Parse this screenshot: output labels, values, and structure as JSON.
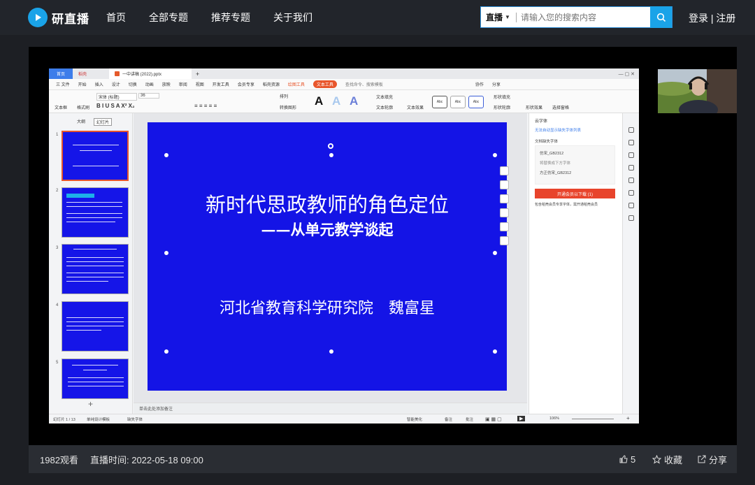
{
  "site": {
    "brand": "研直播",
    "nav": [
      "首页",
      "全部专题",
      "推荐专题",
      "关于我们"
    ],
    "search_type": "直播",
    "search_placeholder": "请输入您的搜索内容",
    "login": "登录",
    "register": "注册",
    "accent": "#1aa3e8"
  },
  "app": {
    "tabs": {
      "home": "首页",
      "docs": "稻壳",
      "file": "一中讲稿 (2022).pptx"
    },
    "menu": [
      "三 文件",
      "开始",
      "插入",
      "设计",
      "切换",
      "动画",
      "放映",
      "审阅",
      "视图",
      "开发工具",
      "会员专享",
      "稻壳资源"
    ],
    "menu_orange": "绘图工具",
    "menu_active": "文本工具",
    "search_cmd": "查找命令、搜索模板",
    "share": [
      "协作",
      "分享"
    ],
    "ribbon": {
      "font": "宋体 (标题)",
      "size": "36",
      "textbox": "文本框",
      "style": "格式刷",
      "layout": "排列",
      "convert": "转换图形",
      "fill": "文本填充",
      "outline": "文本轮廓",
      "effect": "文本效果",
      "abc": "Abc",
      "shape_fill": "形状填充",
      "shape_outline": "形状轮廓",
      "shape_effect": "形状效果",
      "arrange": "选择窗格"
    },
    "left_tabs": [
      "大纲",
      "幻灯片"
    ],
    "thumb_numbers": [
      "1",
      "2",
      "3",
      "4",
      "5"
    ],
    "slide": {
      "title": "新时代思政教师的角色定位",
      "subtitle": "——从单元教学谈起",
      "author": "河北省教育科学研究院　魏富星",
      "color": "#1414e6"
    },
    "notes": "单击此处添加备注",
    "right_pane": {
      "title": "云字体",
      "link": "无法自动显示缺失字体列表",
      "section": "文档缺失字体",
      "card": [
        "仿宋_GB2312",
        "将替换成下方字体",
        "方正仿宋_GB2312"
      ],
      "button": "开通会员以下载 (1)",
      "warn": "包含稻壳会员专享字体，需开通稻壳会员"
    },
    "status": {
      "slide_no": "幻灯片 1 / 13",
      "design": "单纯设计模板",
      "font_missing": "缺失字体",
      "smart": "智能美化",
      "notes": "备注",
      "comment": "批注",
      "zoom": "106%"
    }
  },
  "footer": {
    "views": "1982观看",
    "time": "直播时间: 2022-05-18 09:00",
    "likes": "5",
    "favorite": "收藏",
    "share": "分享"
  }
}
